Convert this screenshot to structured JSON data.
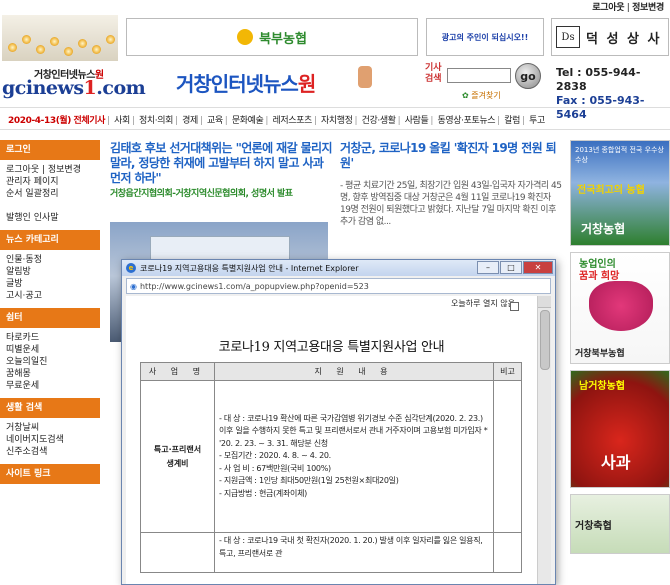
{
  "top_links": {
    "logout": "로그아웃",
    "sep": "|",
    "info_change": "정보변경"
  },
  "banners": {
    "nh_label": "북부농협",
    "ad_text": "광고의 주인이 되십시오!!",
    "ds_logo": "Ds",
    "ds_name": "덕 성 상 사"
  },
  "site": {
    "small_name_prefix": "거창인터넷뉴스",
    "small_name_suffix": "원",
    "domain_main": "gcinews",
    "domain_num": "1",
    "domain_tld": ".com",
    "title_main": "거창인터넷뉴스",
    "title_suffix": "원"
  },
  "search": {
    "label": "기사\n검색",
    "go": "go",
    "favorites": "즐겨찾기"
  },
  "contact": {
    "tel": "Tel : 055-944-2838",
    "fax": "Fax : 055-943-5464"
  },
  "nav": {
    "date": "2020-4-13(월)",
    "items": [
      "전체기사",
      "사회",
      "정치·의회",
      "경제",
      "교육",
      "문화예술",
      "레저스포츠",
      "자치행정",
      "건강·생활",
      "사람들",
      "동영상·포토뉴스",
      "칼럼",
      "투고"
    ]
  },
  "sidebar": [
    {
      "head": "로그인",
      "items": [
        "로그아웃 | 정보변경",
        "관리자 페이지",
        "순서 일괄정리",
        "",
        "발행인 인사말"
      ]
    },
    {
      "head": "뉴스 카테고리",
      "items": [
        "인물·동정",
        "알림방",
        "글방",
        "고시·공고"
      ]
    },
    {
      "head": "쉼터",
      "items": [
        "타로카드",
        "띠별운세",
        "오늘의일진",
        "꿈해몽",
        "무료운세"
      ]
    },
    {
      "head": "생활 검색",
      "items": [
        "거창날씨",
        "네이버지도검색",
        "신주소검색"
      ]
    },
    {
      "head": "사이트 링크",
      "items": []
    }
  ],
  "articles": {
    "a1_title": "김태호 후보 선거대책위는 \"언론에 재갈 물리지 말라, 정당한 취재에 고발부터 하지 말고 사과 먼저 하라\"",
    "a1_sub": "거창읍간지협의회-거창지역신문협의회, 성명서 발표",
    "a2_title": "거창군, 코로나19 올킬 '확진자 19명 전원 퇴원'",
    "a2_body": "- 평균 치료기간 25일, 최장기간 입원 43일-입국자 자가격리 45명, 향후 방역집중 대상 거창군은 4월 11일 코로나19 확진자 19명 전원이 퇴원했다고 밝혔다. 지난달 7일 마지막 확진 이후 추가 감염 없..."
  },
  "right_ads": {
    "ad1_top": "2013년 종합업적 전국 우수상 수상",
    "ad1_mid": "전국최고의 농협",
    "ad1_bottom": "거창농협",
    "ad2_line1": "농업인의",
    "ad2_line2": "꿈과 희망",
    "ad2_footer": "거창북부농협",
    "ad3_top": "남거창농협",
    "ad3_bottom": "사과",
    "ad4_footer": "거창축협"
  },
  "popup": {
    "window_title": "코로나19 지역고용대응 특별지원사업 안내 - Internet Explorer",
    "url": "http://www.gcinews1.com/a_popupview.php?openid=523",
    "no_show_today": "오늘하루 열지 않음",
    "notice_title": "코로나19 지역고용대응 특별지원사업 안내",
    "headers": [
      "사 업 명",
      "지 원 내 용",
      "비고"
    ],
    "row1_category": "특고·프리랜서\n생계비",
    "row1_lines": [
      "- 대  상 : 코로나19 확산에 따른 국가감염병 위기경보 수준 심각단계(2020. 2. 23.) 이후 일을 수행하지 못한 특고 및 프리랜서로서 관내 거주자이며 고용보험 미가입자 * '20. 2. 23. ~ 3. 31. 해당분 신청",
      "- 모집기간 : 2020. 4. 8. ~ 4. 20.",
      "- 사 업 비 : 67백만원(국비 100%)",
      "- 지원금액 : 1인당 최대50만원(1일 25천원×최대20일)",
      "- 지급방법 : 현금(계좌이체)"
    ],
    "row2_lines": [
      "- 대    상 : 코로나19 국내 첫 확진자(2020. 1. 20.) 발생 이후 일자리를 잃은 일용직, 특고, 프리랜서로 관"
    ]
  }
}
